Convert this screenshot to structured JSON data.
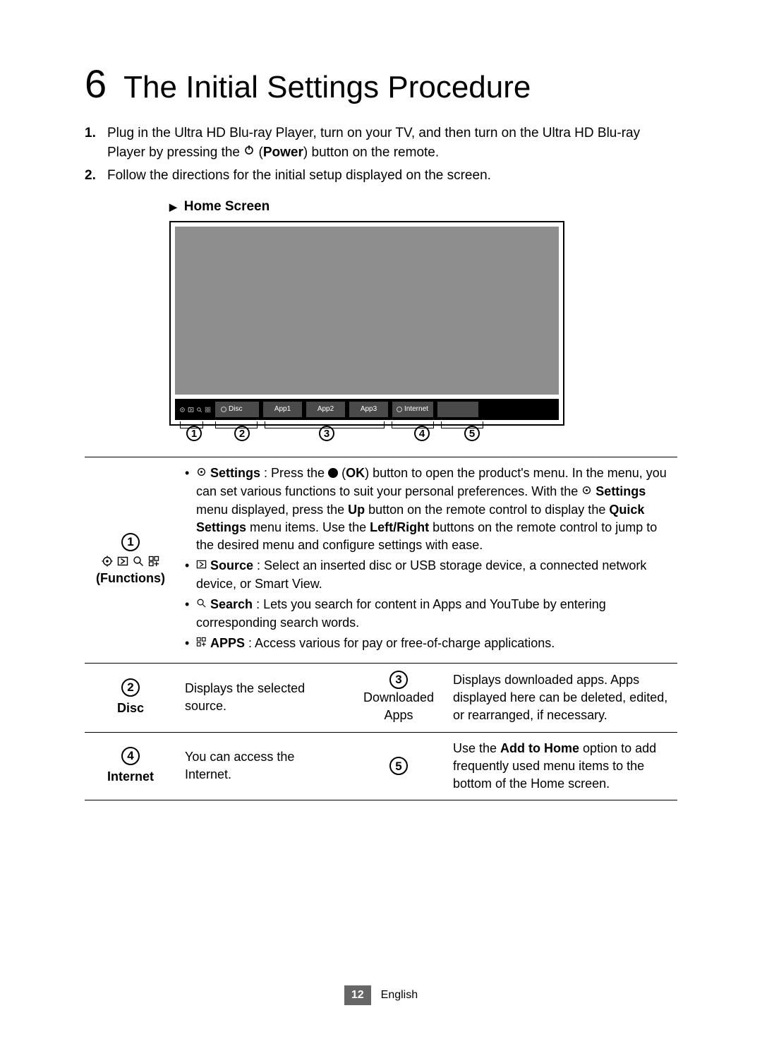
{
  "chapter": {
    "num": "6",
    "title": "The Initial Settings Procedure"
  },
  "steps": {
    "s1_pre": "Plug in the Ultra HD Blu-ray Player, turn on your TV, and then turn on the Ultra HD Blu-ray Player by pressing the ",
    "s1_power": "Power",
    "s1_post": ") button on the remote.",
    "s2": "Follow the directions for the initial setup displayed on the screen."
  },
  "home_heading": "Home Screen",
  "tiles": {
    "disc": "Disc",
    "app1": "App1",
    "app2": "App2",
    "app3": "App3",
    "internet": "Internet"
  },
  "callout_nums": {
    "c1": "1",
    "c2": "2",
    "c3": "3",
    "c4": "4",
    "c5": "5"
  },
  "row1": {
    "label": "(Functions)",
    "settings_b": "Settings",
    "settings_1": " : Press the ",
    "ok": "OK",
    "settings_2": ") button to open the product's menu. In the menu, you can set various functions to suit your personal preferences. With the ",
    "settings_b2": "Settings",
    "settings_3": " menu displayed, press the ",
    "up": "Up",
    "settings_4": " button on the remote control to display the ",
    "quick": "Quick Settings",
    "settings_5": " menu items. Use the ",
    "lr": "Left/Right",
    "settings_6": " buttons on the remote control to jump to the desired menu and configure settings with ease.",
    "source_b": "Source",
    "source_t": " : Select an inserted disc or USB storage device, a connected network device, or Smart View.",
    "search_b": "Search",
    "search_t": " : Lets you search for content in Apps and YouTube by entering corresponding search words.",
    "apps_b": "APPS",
    "apps_t": " : Access various for pay or free-of-charge applications."
  },
  "row2": {
    "n2": "2",
    "disc_lbl": "Disc",
    "disc_t": "Displays the selected source.",
    "n3": "3",
    "dl_lbl1": "Downloaded",
    "dl_lbl2": "Apps",
    "dl_t": "Displays downloaded apps. Apps displayed here can be deleted, edited, or rearranged, if necessary."
  },
  "row3": {
    "n4": "4",
    "inet_lbl": "Internet",
    "inet_t": "You can access the Internet.",
    "n5": "5",
    "add_pre": "Use the ",
    "add_b": "Add to Home",
    "add_post": " option to add frequently used menu items to the bottom of the Home screen."
  },
  "footer": {
    "page": "12",
    "lang": "English"
  }
}
